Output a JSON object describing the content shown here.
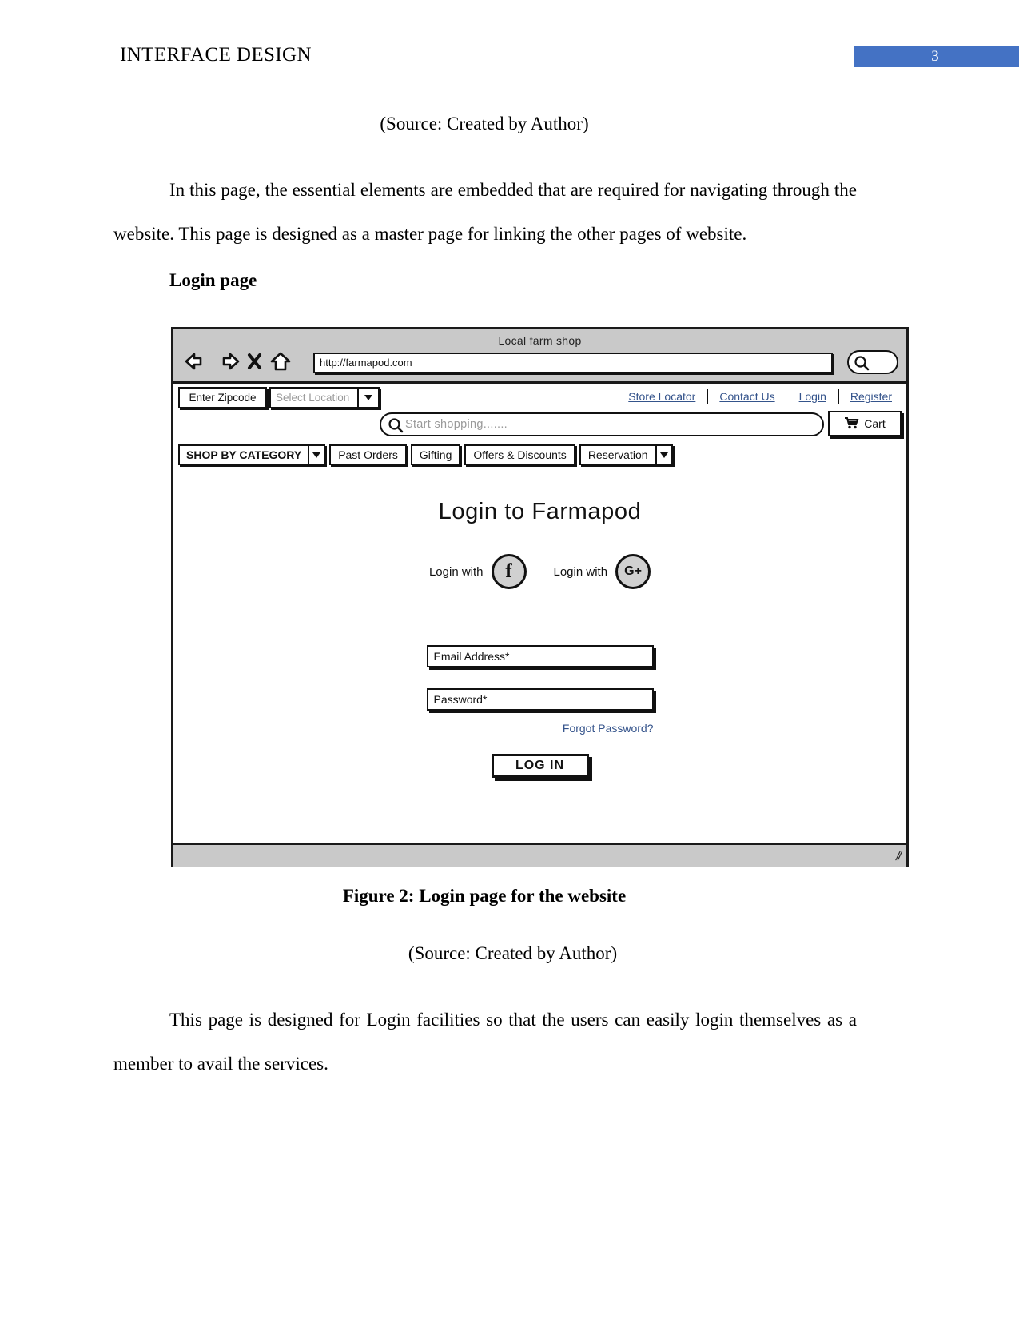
{
  "header": {
    "title": "INTERFACE DESIGN",
    "page_number": "3",
    "badge_color": "#4472C4"
  },
  "document": {
    "source_caption_top": "(Source: Created by Author)",
    "paragraph_1": "In this page, the essential elements are embedded that are required for navigating through the website. This page is designed as a master page for linking the other pages of website.",
    "section_heading": "Login page",
    "figure_caption": "Figure 2: Login page for the website",
    "source_caption_bottom": "(Source: Created by Author)",
    "paragraph_2": "This page is designed for Login facilities so that the users can easily login themselves as a member to avail the services."
  },
  "mockup": {
    "browser": {
      "window_title": "Local farm shop",
      "url_value": "http://farmapod.com",
      "nav_icons": [
        "back-arrow-icon",
        "forward-arrow-icon",
        "stop-x-icon",
        "home-icon"
      ],
      "search_icon": "magnifier-icon"
    },
    "site_header": {
      "zipcode_button": "Enter Zipcode",
      "location_select_placeholder": "Select Location",
      "top_links": [
        "Store Locator",
        "Contact Us",
        "Login",
        "Register"
      ],
      "shop_search_placeholder": "Start shopping.......",
      "shop_search_icon": "magnifier-icon",
      "cart_label": "Cart",
      "cart_icon": "shopping-cart-icon",
      "link_color": "#34538b"
    },
    "category_nav": {
      "main": "SHOP BY CATEGORY",
      "items": [
        {
          "label": "Past Orders",
          "has_caret": false
        },
        {
          "label": "Gifting",
          "has_caret": false
        },
        {
          "label": "Offers & Discounts",
          "has_caret": false
        },
        {
          "label": "Reservation",
          "has_caret": true
        }
      ]
    },
    "login": {
      "heading": "Login to Farmapod",
      "social": [
        {
          "label": "Login with",
          "icon": "facebook-icon",
          "glyph": "f"
        },
        {
          "label": "Login with",
          "icon": "google-plus-icon",
          "glyph": "G+"
        }
      ],
      "email_label": "Email Address*",
      "password_label": "Password*",
      "forgot_label": "Forgot Password?",
      "submit_label": "LOG IN"
    },
    "status_bar": {
      "resize_grip": "//"
    }
  }
}
